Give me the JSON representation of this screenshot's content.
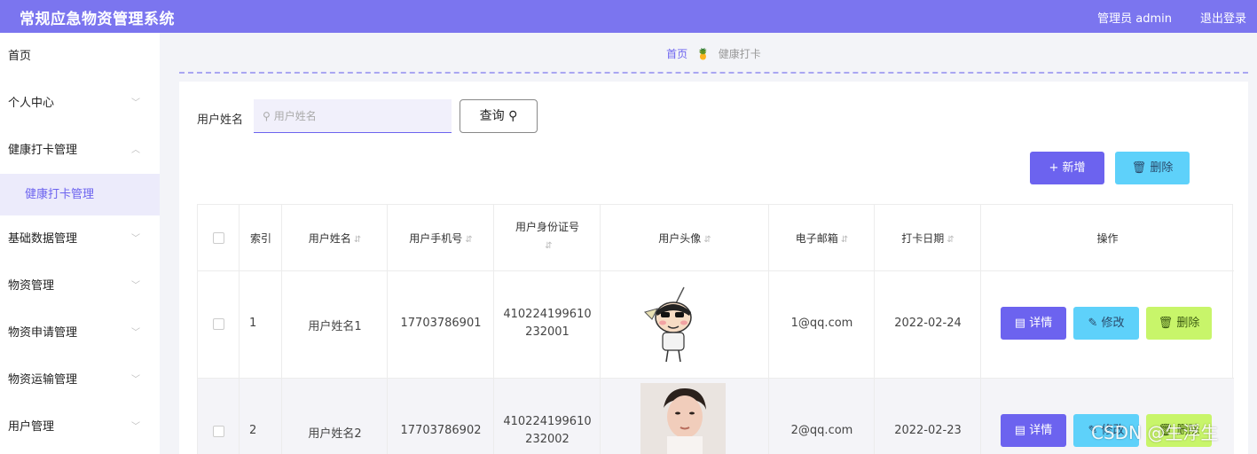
{
  "app": {
    "title": "常规应急物资管理系统",
    "admin": "管理员 admin",
    "logout": "退出登录"
  },
  "sidebar": {
    "items": [
      {
        "label": "首页",
        "chevron": ""
      },
      {
        "label": "个人中心",
        "chevron": "﹀"
      },
      {
        "label": "健康打卡管理",
        "chevron": "︿"
      },
      {
        "label": "健康打卡管理",
        "chevron": ""
      },
      {
        "label": "基础数据管理",
        "chevron": "﹀"
      },
      {
        "label": "物资管理",
        "chevron": "﹀"
      },
      {
        "label": "物资申请管理",
        "chevron": "﹀"
      },
      {
        "label": "物资运输管理",
        "chevron": "﹀"
      },
      {
        "label": "用户管理",
        "chevron": "﹀"
      }
    ]
  },
  "breadcrumb": {
    "home": "首页",
    "current": "健康打卡"
  },
  "search": {
    "label": "用户姓名",
    "placeholder": "用户姓名",
    "query_label": "查询"
  },
  "toolbar": {
    "add_label": "新增",
    "delete_label": "删除"
  },
  "table": {
    "headers": [
      "索引",
      "用户姓名",
      "用户手机号",
      "用户身份证号",
      "用户头像",
      "电子邮箱",
      "打卡日期",
      "操作"
    ],
    "rows": [
      {
        "index": "1",
        "name": "用户姓名1",
        "phone": "17703786901",
        "id1": "410224199610",
        "id2": "232001",
        "email": "1@qq.com",
        "date": "2022-02-24"
      },
      {
        "index": "2",
        "name": "用户姓名2",
        "phone": "17703786902",
        "id1": "410224199610",
        "id2": "232002",
        "email": "2@qq.com",
        "date": "2022-02-23"
      }
    ],
    "actions": {
      "detail": "详情",
      "edit": "修改",
      "delete": "删除"
    }
  },
  "watermark": "CSDN @生浮生",
  "colors": {
    "brand": "#7b75ef",
    "accent": "#6c63ef",
    "cyan": "#5ed1fa",
    "lime": "#c8f56a"
  }
}
